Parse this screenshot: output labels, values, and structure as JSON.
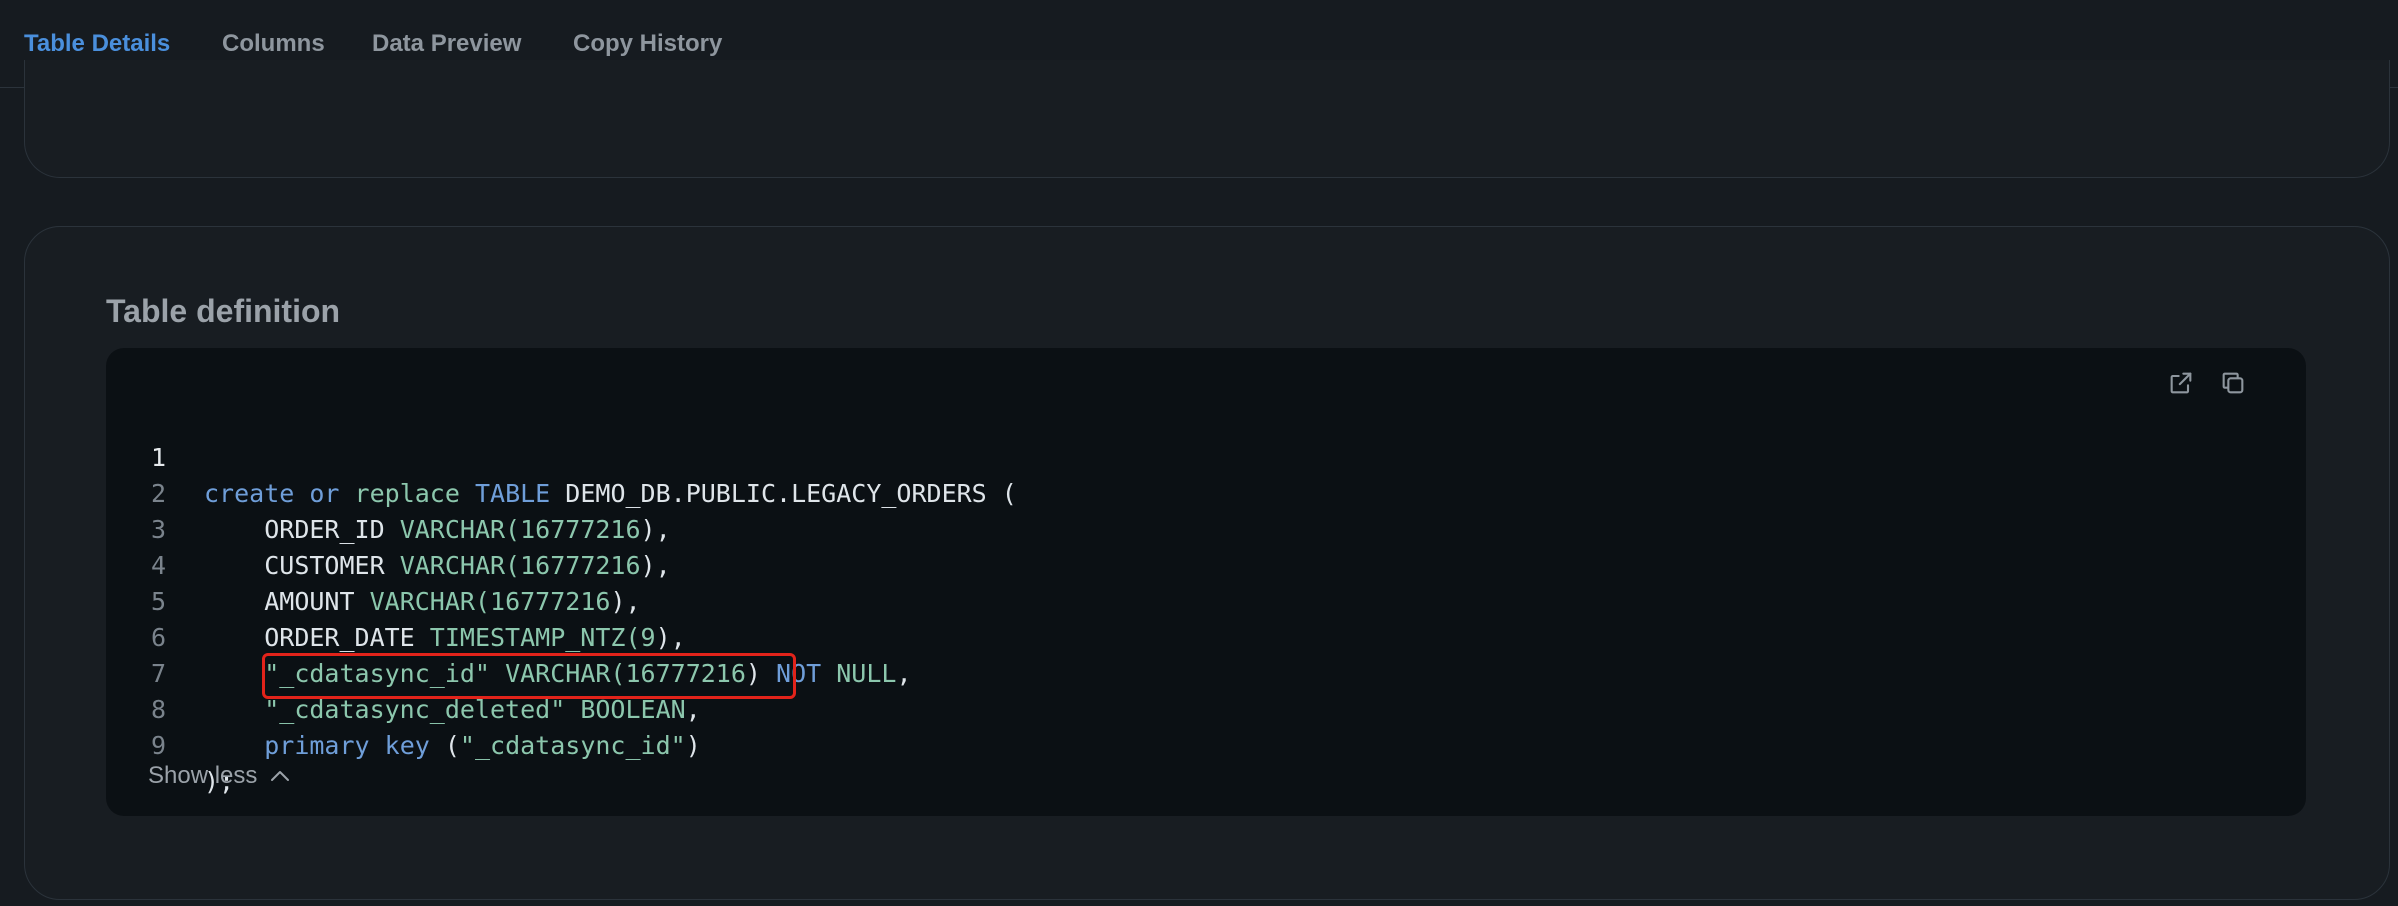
{
  "tabs": [
    {
      "label": "Table Details",
      "active": true
    },
    {
      "label": "Columns",
      "active": false
    },
    {
      "label": "Data Preview",
      "active": false
    },
    {
      "label": "Copy History",
      "active": false
    }
  ],
  "section": {
    "title": "Table definition",
    "show_less_label": "Show less"
  },
  "icons": {
    "open": "external-link-icon",
    "copy": "copy-icon",
    "chevron": "chevron-up-icon"
  },
  "code": {
    "line_numbers": [
      "1",
      "2",
      "3",
      "4",
      "5",
      "6",
      "7",
      "8",
      "9"
    ],
    "l1": {
      "kw1": "create",
      "kw2": "or",
      "kw3": "replace",
      "kw4": "TABLE",
      "name": "DEMO_DB.PUBLIC.LEGACY_ORDERS",
      "tail": "("
    },
    "l2": {
      "col": "ORDER_ID",
      "type": "VARCHAR(",
      "num": "16777216",
      "tail": "),"
    },
    "l3": {
      "col": "CUSTOMER",
      "type": "VARCHAR(",
      "num": "16777216",
      "tail": "),"
    },
    "l4": {
      "col": "AMOUNT",
      "type": "VARCHAR(",
      "num": "16777216",
      "tail": "),"
    },
    "l5": {
      "col": "ORDER_DATE",
      "type": "TIMESTAMP_NTZ(",
      "num": "9",
      "tail": "),"
    },
    "l6": {
      "col": "\"_cdatasync_id\"",
      "type": "VARCHAR(",
      "num": "16777216",
      "close": ")",
      "kw": "NOT",
      "nul": "NULL",
      "tail": ","
    },
    "l7": {
      "col": "\"_cdatasync_deleted\"",
      "type": "BOOLEAN",
      "tail": ","
    },
    "l8": {
      "kw1": "primary",
      "kw2": "key",
      "open": "(",
      "str": "\"_cdatasync_id\"",
      "close": ")"
    },
    "l9": {
      "text": ");"
    }
  },
  "colors": {
    "accent": "#4a8fdc",
    "keyword": "#6f9ed9",
    "type": "#8cc7ad",
    "highlight_box": "#e2231a"
  }
}
